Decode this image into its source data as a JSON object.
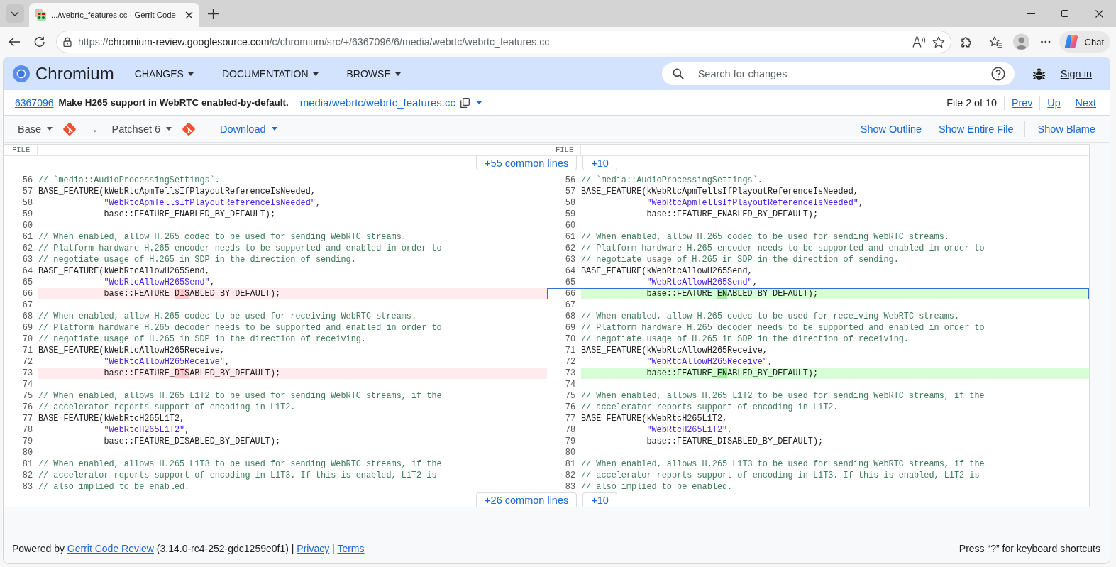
{
  "browser": {
    "tab": {
      "title": ".../webrtc_features.cc · Gerrit Code",
      "selected": true
    },
    "address_bar": {
      "scheme": "https://",
      "host": "chromium-review.googlesource.com",
      "path": "/c/chromium/src/+/6367096/6/media/webrtc/webrtc_features.cc"
    },
    "chat_button": "Chat"
  },
  "header": {
    "brand": "Chromium",
    "menus": [
      "CHANGES",
      "DOCUMENTATION",
      "BROWSE"
    ],
    "search": {
      "placeholder": "Search for changes"
    },
    "sign_in": "Sign in"
  },
  "change": {
    "number": "6367096",
    "subject": "Make H265 support in WebRTC enabled-by-default.",
    "file_path": "media/webrtc/webrtc_features.cc",
    "file_position": "File 2 of 10",
    "nav_links": [
      "Prev",
      "Up",
      "Next"
    ]
  },
  "toolbar": {
    "base": "Base",
    "arrow": "→",
    "patchset": "Patchset 6",
    "download": "Download",
    "actions": [
      "Show Outline",
      "Show Entire File",
      "Show Blame"
    ]
  },
  "diff": {
    "headers": [
      "FILE",
      "FILE"
    ],
    "context_above": {
      "common_lines": "+55 common lines",
      "more": "+10"
    },
    "rows": [
      {
        "left": {
          "number": "56",
          "kind": "context",
          "selected": false,
          "segments": [
            {
              "kind": "comment",
              "text": "// `media::AudioProcessingSettings`."
            }
          ]
        },
        "right": {
          "number": "56",
          "kind": "context",
          "selected": false,
          "segments": [
            {
              "kind": "comment",
              "text": "// `media::AudioProcessingSettings`."
            }
          ]
        }
      },
      {
        "left": {
          "number": "57",
          "kind": "context",
          "selected": false,
          "segments": [
            {
              "kind": "code",
              "text": "BASE_FEATURE(kWebRtcApmTellsIfPlayoutReferenceIsNeeded,"
            }
          ]
        },
        "right": {
          "number": "57",
          "kind": "context",
          "selected": false,
          "segments": [
            {
              "kind": "code",
              "text": "BASE_FEATURE(kWebRtcApmTellsIfPlayoutReferenceIsNeeded,"
            }
          ]
        }
      },
      {
        "left": {
          "number": "58",
          "kind": "context",
          "selected": false,
          "segments": [
            {
              "kind": "string",
              "text": "             \"WebRtcApmTellsIfPlayoutReferenceIsNeeded\""
            },
            {
              "kind": "code",
              "text": ","
            }
          ]
        },
        "right": {
          "number": "58",
          "kind": "context",
          "selected": false,
          "segments": [
            {
              "kind": "string",
              "text": "             \"WebRtcApmTellsIfPlayoutReferenceIsNeeded\""
            },
            {
              "kind": "code",
              "text": ","
            }
          ]
        }
      },
      {
        "left": {
          "number": "59",
          "kind": "context",
          "selected": false,
          "segments": [
            {
              "kind": "code",
              "text": "             base::FEATURE_ENABLED_BY_DEFAULT);"
            }
          ]
        },
        "right": {
          "number": "59",
          "kind": "context",
          "selected": false,
          "segments": [
            {
              "kind": "code",
              "text": "             base::FEATURE_ENABLED_BY_DEFAULT);"
            }
          ]
        }
      },
      {
        "left": {
          "number": "60",
          "kind": "context",
          "selected": false
        },
        "right": {
          "number": "60",
          "kind": "context",
          "selected": false
        }
      },
      {
        "left": {
          "number": "61",
          "kind": "context",
          "selected": false,
          "segments": [
            {
              "kind": "comment",
              "text": "// When enabled, allow H.265 codec to be used for sending WebRTC streams."
            }
          ]
        },
        "right": {
          "number": "61",
          "kind": "context",
          "selected": false,
          "segments": [
            {
              "kind": "comment",
              "text": "// When enabled, allow H.265 codec to be used for sending WebRTC streams."
            }
          ]
        }
      },
      {
        "left": {
          "number": "62",
          "kind": "context",
          "selected": false,
          "segments": [
            {
              "kind": "comment",
              "text": "// Platform hardware H.265 encoder needs to be supported and enabled in order to"
            }
          ]
        },
        "right": {
          "number": "62",
          "kind": "context",
          "selected": false,
          "segments": [
            {
              "kind": "comment",
              "text": "// Platform hardware H.265 encoder needs to be supported and enabled in order to"
            }
          ]
        }
      },
      {
        "left": {
          "number": "63",
          "kind": "context",
          "selected": false,
          "segments": [
            {
              "kind": "comment",
              "text": "// negotiate usage of H.265 in SDP in the direction of sending."
            }
          ]
        },
        "right": {
          "number": "63",
          "kind": "context",
          "selected": false,
          "segments": [
            {
              "kind": "comment",
              "text": "// negotiate usage of H.265 in SDP in the direction of sending."
            }
          ]
        }
      },
      {
        "left": {
          "number": "64",
          "kind": "context",
          "selected": false,
          "segments": [
            {
              "kind": "code",
              "text": "BASE_FEATURE(kWebRtcAllowH265Send,"
            }
          ]
        },
        "right": {
          "number": "64",
          "kind": "context",
          "selected": false,
          "segments": [
            {
              "kind": "code",
              "text": "BASE_FEATURE(kWebRtcAllowH265Send,"
            }
          ]
        }
      },
      {
        "left": {
          "number": "65",
          "kind": "context",
          "selected": false,
          "segments": [
            {
              "kind": "string",
              "text": "             \"WebRtcAllowH265Send\""
            },
            {
              "kind": "code",
              "text": ","
            }
          ]
        },
        "right": {
          "number": "65",
          "kind": "context",
          "selected": false,
          "segments": [
            {
              "kind": "string",
              "text": "             \"WebRtcAllowH265Send\""
            },
            {
              "kind": "code",
              "text": ","
            }
          ]
        }
      },
      {
        "left": {
          "number": "66",
          "kind": "removed",
          "selected": false,
          "segments": [
            {
              "kind": "code",
              "text": "             base::FEATURE_"
            },
            {
              "kind": "changed",
              "text": "DIS"
            },
            {
              "kind": "code",
              "text": "ABLED_BY_DEFAULT);"
            }
          ]
        },
        "right": {
          "number": "66",
          "kind": "added",
          "selected": true,
          "segments": [
            {
              "kind": "code",
              "text": "             base::FEATURE_"
            },
            {
              "kind": "changed",
              "text": "EN"
            },
            {
              "kind": "code",
              "text": "ABLED_BY_DEFAULT);"
            }
          ]
        }
      },
      {
        "left": {
          "number": "67",
          "kind": "context",
          "selected": false
        },
        "right": {
          "number": "67",
          "kind": "context",
          "selected": false
        }
      },
      {
        "left": {
          "number": "68",
          "kind": "context",
          "selected": false,
          "segments": [
            {
              "kind": "comment",
              "text": "// When enabled, allow H.265 codec to be used for receiving WebRTC streams."
            }
          ]
        },
        "right": {
          "number": "68",
          "kind": "context",
          "selected": false,
          "segments": [
            {
              "kind": "comment",
              "text": "// When enabled, allow H.265 codec to be used for receiving WebRTC streams."
            }
          ]
        }
      },
      {
        "left": {
          "number": "69",
          "kind": "context",
          "selected": false,
          "segments": [
            {
              "kind": "comment",
              "text": "// Platform hardware H.265 decoder needs to be supported and enabled in order to"
            }
          ]
        },
        "right": {
          "number": "69",
          "kind": "context",
          "selected": false,
          "segments": [
            {
              "kind": "comment",
              "text": "// Platform hardware H.265 decoder needs to be supported and enabled in order to"
            }
          ]
        }
      },
      {
        "left": {
          "number": "70",
          "kind": "context",
          "selected": false,
          "segments": [
            {
              "kind": "comment",
              "text": "// negotiate usage of H.265 in SDP in the direction of receiving."
            }
          ]
        },
        "right": {
          "number": "70",
          "kind": "context",
          "selected": false,
          "segments": [
            {
              "kind": "comment",
              "text": "// negotiate usage of H.265 in SDP in the direction of receiving."
            }
          ]
        }
      },
      {
        "left": {
          "number": "71",
          "kind": "context",
          "selected": false,
          "segments": [
            {
              "kind": "code",
              "text": "BASE_FEATURE(kWebRtcAllowH265Receive,"
            }
          ]
        },
        "right": {
          "number": "71",
          "kind": "context",
          "selected": false,
          "segments": [
            {
              "kind": "code",
              "text": "BASE_FEATURE(kWebRtcAllowH265Receive,"
            }
          ]
        }
      },
      {
        "left": {
          "number": "72",
          "kind": "context",
          "selected": false,
          "segments": [
            {
              "kind": "string",
              "text": "             \"WebRtcAllowH265Receive\""
            },
            {
              "kind": "code",
              "text": ","
            }
          ]
        },
        "right": {
          "number": "72",
          "kind": "context",
          "selected": false,
          "segments": [
            {
              "kind": "string",
              "text": "             \"WebRtcAllowH265Receive\""
            },
            {
              "kind": "code",
              "text": ","
            }
          ]
        }
      },
      {
        "left": {
          "number": "73",
          "kind": "removed",
          "selected": false,
          "segments": [
            {
              "kind": "code",
              "text": "             base::FEATURE_"
            },
            {
              "kind": "changed",
              "text": "DIS"
            },
            {
              "kind": "code",
              "text": "ABLED_BY_DEFAULT);"
            }
          ]
        },
        "right": {
          "number": "73",
          "kind": "added",
          "selected": false,
          "segments": [
            {
              "kind": "code",
              "text": "             base::FEATURE_"
            },
            {
              "kind": "changed",
              "text": "EN"
            },
            {
              "kind": "code",
              "text": "ABLED_BY_DEFAULT);"
            }
          ]
        }
      },
      {
        "left": {
          "number": "74",
          "kind": "context",
          "selected": false
        },
        "right": {
          "number": "74",
          "kind": "context",
          "selected": false
        }
      },
      {
        "left": {
          "number": "75",
          "kind": "context",
          "selected": false,
          "segments": [
            {
              "kind": "comment",
              "text": "// When enabled, allows H.265 L1T2 to be used for sending WebRTC streams, if the"
            }
          ]
        },
        "right": {
          "number": "75",
          "kind": "context",
          "selected": false,
          "segments": [
            {
              "kind": "comment",
              "text": "// When enabled, allows H.265 L1T2 to be used for sending WebRTC streams, if the"
            }
          ]
        }
      },
      {
        "left": {
          "number": "76",
          "kind": "context",
          "selected": false,
          "segments": [
            {
              "kind": "comment",
              "text": "// accelerator reports support of encoding in L1T2."
            }
          ]
        },
        "right": {
          "number": "76",
          "kind": "context",
          "selected": false,
          "segments": [
            {
              "kind": "comment",
              "text": "// accelerator reports support of encoding in L1T2."
            }
          ]
        }
      },
      {
        "left": {
          "number": "77",
          "kind": "context",
          "selected": false,
          "segments": [
            {
              "kind": "code",
              "text": "BASE_FEATURE(kWebRtcH265L1T2,"
            }
          ]
        },
        "right": {
          "number": "77",
          "kind": "context",
          "selected": false,
          "segments": [
            {
              "kind": "code",
              "text": "BASE_FEATURE(kWebRtcH265L1T2,"
            }
          ]
        }
      },
      {
        "left": {
          "number": "78",
          "kind": "context",
          "selected": false,
          "segments": [
            {
              "kind": "string",
              "text": "             \"WebRtcH265L1T2\""
            },
            {
              "kind": "code",
              "text": ","
            }
          ]
        },
        "right": {
          "number": "78",
          "kind": "context",
          "selected": false,
          "segments": [
            {
              "kind": "string",
              "text": "             \"WebRtcH265L1T2\""
            },
            {
              "kind": "code",
              "text": ","
            }
          ]
        }
      },
      {
        "left": {
          "number": "79",
          "kind": "context",
          "selected": false,
          "segments": [
            {
              "kind": "code",
              "text": "             base::FEATURE_DISABLED_BY_DEFAULT);"
            }
          ]
        },
        "right": {
          "number": "79",
          "kind": "context",
          "selected": false,
          "segments": [
            {
              "kind": "code",
              "text": "             base::FEATURE_DISABLED_BY_DEFAULT);"
            }
          ]
        }
      },
      {
        "left": {
          "number": "80",
          "kind": "context",
          "selected": false
        },
        "right": {
          "number": "80",
          "kind": "context",
          "selected": false
        }
      },
      {
        "left": {
          "number": "81",
          "kind": "context",
          "selected": false,
          "segments": [
            {
              "kind": "comment",
              "text": "// When enabled, allows H.265 L1T3 to be used for sending WebRTC streams, if the"
            }
          ]
        },
        "right": {
          "number": "81",
          "kind": "context",
          "selected": false,
          "segments": [
            {
              "kind": "comment",
              "text": "// When enabled, allows H.265 L1T3 to be used for sending WebRTC streams, if the"
            }
          ]
        }
      },
      {
        "left": {
          "number": "82",
          "kind": "context",
          "selected": false,
          "segments": [
            {
              "kind": "comment",
              "text": "// accelerator reports support of encoding in L1T3. If this is enabled, L1T2 is"
            }
          ]
        },
        "right": {
          "number": "82",
          "kind": "context",
          "selected": false,
          "segments": [
            {
              "kind": "comment",
              "text": "// accelerator reports support of encoding in L1T3. If this is enabled, L1T2 is"
            }
          ]
        }
      },
      {
        "left": {
          "number": "83",
          "kind": "context",
          "selected": false,
          "segments": [
            {
              "kind": "comment",
              "text": "// also implied to be enabled."
            }
          ]
        },
        "right": {
          "number": "83",
          "kind": "context",
          "selected": false,
          "segments": [
            {
              "kind": "comment",
              "text": "// also implied to be enabled."
            }
          ]
        }
      }
    ],
    "context_below": {
      "common_lines": "+26 common lines",
      "more": "+10"
    }
  },
  "footer": {
    "segments": [
      {
        "kind": "text",
        "text": "Powered by "
      },
      {
        "kind": "link",
        "text": "Gerrit Code Review"
      },
      {
        "kind": "text",
        "text": " (3.14.0-rc4-252-gdc1259e0f1) | "
      },
      {
        "kind": "link",
        "text": "Privacy"
      },
      {
        "kind": "text",
        "text": " | "
      },
      {
        "kind": "link",
        "text": "Terms"
      }
    ],
    "shortcut_hint": "Press “?” for keyboard shortcuts"
  }
}
